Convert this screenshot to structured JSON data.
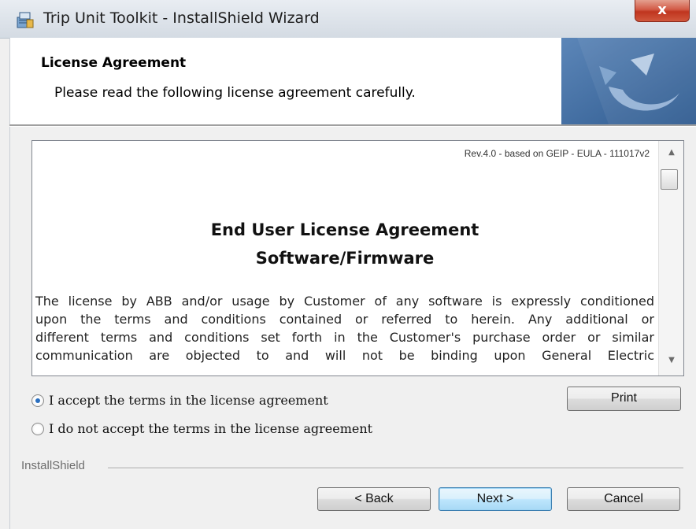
{
  "window": {
    "title": "Trip Unit Toolkit - InstallShield Wizard",
    "close_symbol": "x",
    "app_icon": "installer-icon"
  },
  "header": {
    "title": "License Agreement",
    "subtitle": "Please read the following license agreement carefully.",
    "art_icon": "installshield-logo-icon"
  },
  "license": {
    "revision": "Rev.4.0 - based on GEIP - EULA - 111017v2",
    "heading_line1": "End User License Agreement",
    "heading_line2": "Software/Firmware",
    "body_lines": [
      "The license by ABB and/or usage by Customer of any software is expressly conditioned",
      "upon the terms and conditions contained or referred to herein.  Any additional or",
      "different terms and conditions set forth in the Customer's purchase order or similar",
      "communication are objected to and will not be binding upon General Electric"
    ],
    "scroll_position": 0
  },
  "options": {
    "accept_label": "I accept the terms in the license agreement",
    "decline_label": "I do not accept the terms in the license agreement",
    "selected": "accept"
  },
  "buttons": {
    "print": "Print",
    "back": "< Back",
    "next": "Next >",
    "cancel": "Cancel"
  },
  "footer": {
    "brand": "InstallShield"
  },
  "colors": {
    "close_button": "#c0351f",
    "next_button_border": "#3c7fb1",
    "radio_selected": "#2a6fbf",
    "header_art": "#3b6ea5"
  }
}
